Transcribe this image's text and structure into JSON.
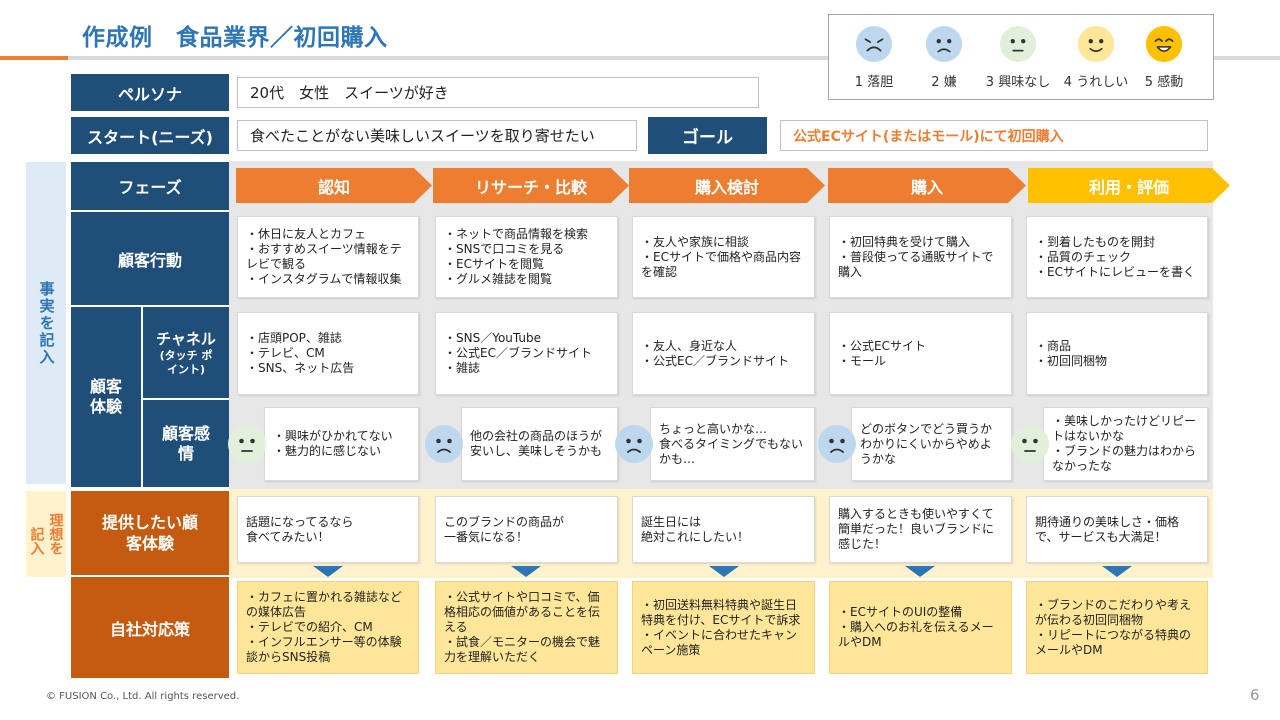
{
  "title": "作成例　食品業界／初回購入",
  "legend": [
    {
      "label": "1 落胆",
      "face": "disappointed"
    },
    {
      "label": "2 嫌",
      "face": "dislike"
    },
    {
      "label": "3 興味なし",
      "face": "neutral"
    },
    {
      "label": "4 うれしい",
      "face": "happy"
    },
    {
      "label": "5 感動",
      "face": "delighted"
    }
  ],
  "persona": {
    "label": "ペルソナ",
    "value": "20代　女性　スイーツが好き"
  },
  "start": {
    "label": "スタート(ニーズ)",
    "value": "食べたことがない美味しいスイーツを取り寄せたい"
  },
  "goal": {
    "label": "ゴール",
    "value": "公式ECサイト(またはモール)にて初回購入"
  },
  "side": {
    "facts": "事実を記入",
    "ideal_a": "理想を",
    "ideal_b": "記入"
  },
  "rows": {
    "phase": "フェーズ",
    "behavior": "顧客行動",
    "experience": "顧客体験",
    "channel": "チャネル",
    "channel_sub": "(タッチ ポイント)",
    "emotion": "顧客感情",
    "ideal": "提供したい顧客体験",
    "measures": "自社対応策"
  },
  "phases": [
    "認知",
    "リサーチ・比較",
    "購入検討",
    "購入",
    "利用・評価"
  ],
  "behavior": [
    "・休日に友人とカフェ\n・おすすめスイーツ情報をテレビで観る\n・インスタグラムで情報収集",
    "・ネットで商品情報を検索\n・SNSで口コミを見る\n・ECサイトを閲覧\n・グルメ雑誌を閲覧",
    "・友人や家族に相談\n・ECサイトで価格や商品内容を確認",
    "・初回特典を受けて購入\n・普段使ってる通販サイトで購入",
    "・到着したものを開封\n・品質のチェック\n・ECサイトにレビューを書く"
  ],
  "channel": [
    "・店頭POP、雑誌\n・テレビ、CM\n・SNS、ネット広告",
    "・SNS／YouTube\n・公式EC／ブランドサイト\n・雑誌",
    "・友人、身近な人\n・公式EC／ブランドサイト",
    "・公式ECサイト\n・モール",
    "・商品\n・初回同梱物"
  ],
  "emotion": [
    {
      "text": "・興味がひかれてない\n・魅力的に感じない",
      "face": "neutral"
    },
    {
      "text": "他の会社の商品のほうが安いし、美味しそうかも",
      "face": "dislike"
    },
    {
      "text": "ちょっと高いかな…\n食べるタイミングでもないかも…",
      "face": "dislike"
    },
    {
      "text": "どのボタンでどう買うかわかりにくいからやめようかな",
      "face": "dislike"
    },
    {
      "text": "・美味しかったけどリピートはないかな\n・ブランドの魅力はわからなかったな",
      "face": "neutral"
    }
  ],
  "ideal": [
    "話題になってるなら\n食べてみたい！",
    "このブランドの商品が\n一番気になる！",
    "誕生日には\n絶対これにしたい！",
    "購入するときも使いやすくて簡単だった！良いブランドに感じた！",
    "期待通りの美味しさ・価格で、サービスも大満足！"
  ],
  "measures": [
    "・カフェに置かれる雑誌などの媒体広告\n・テレビでの紹介、CM\n・インフルエンサー等の体験談からSNS投稿",
    "・公式サイトや口コミで、価格相応の価値があることを伝える\n・試食／モニターの機会で魅力を理解いただく",
    "・初回送料無料特典や誕生日特典を付け、ECサイトで訴求\n・イベントに合わせたキャンペーン施策",
    "・ECサイトのUIの整備\n・購入へのお礼を伝えるメールやDM",
    "・ブランドのこだわりや考えが伝わる初回同梱物\n・リピートにつながる特典のメールやDM"
  ],
  "colors": {
    "navy": "#1F4E79",
    "orange": "#ED7D31",
    "dark_orange": "#C55A11",
    "gold": "#FFC000",
    "light_blue": "#DEEBF7",
    "light_yellow": "#FFF2CC",
    "blue_face": "#BDD7EE",
    "green_face": "#E2EFDA",
    "yellow_face": "#FFE699"
  },
  "footer": "© FUSION Co., Ltd. All rights reserved.",
  "page_number": "6"
}
